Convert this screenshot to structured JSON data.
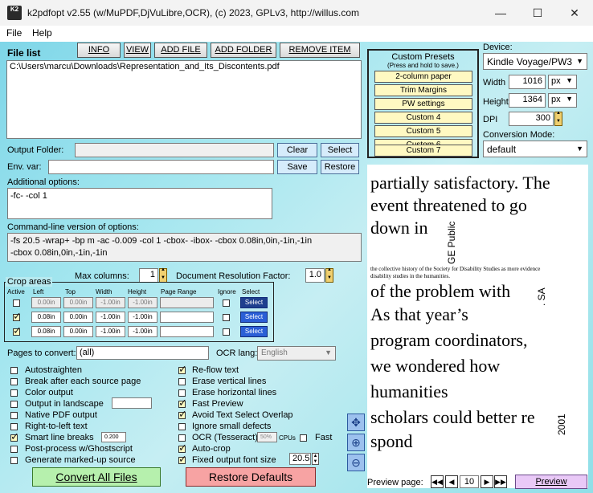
{
  "window": {
    "title": "k2pdfopt v2.55 (w/MuPDF,DjVuLibre,OCR), (c) 2023, GPLv3, http://willus.com",
    "logo": "K2"
  },
  "menu": {
    "file": "File",
    "help": "Help"
  },
  "toolbar": {
    "info": "INFO",
    "view": "VIEW",
    "add_file": "ADD FILE",
    "add_folder": "ADD FOLDER",
    "remove_item": "REMOVE ITEM"
  },
  "file_list": {
    "label": "File list",
    "items": [
      "C:\\Users\\marcu\\Downloads\\Representation_and_Its_Discontents.pdf"
    ]
  },
  "output_folder": {
    "label": "Output Folder:",
    "value": "",
    "clear": "Clear",
    "select": "Select"
  },
  "env_var": {
    "label": "Env. var:",
    "value": "",
    "save": "Save",
    "restore": "Restore"
  },
  "additional_options": {
    "label": "Additional options:",
    "value": "-fc- -col 1"
  },
  "command_line": {
    "label": "Command-line version of options:",
    "line1": "-fs 20.5 -wrap+ -bp m -ac -0.009 -col 1 -cbox- -ibox- -cbox 0.08in,0in,-1in,-1in",
    "line2": "-cbox 0.08in,0in,-1in,-1in"
  },
  "max_columns": {
    "label": "Max columns:",
    "value": "1"
  },
  "doc_res": {
    "label": "Document Resolution Factor:",
    "value": "1.0"
  },
  "crop": {
    "title": "Crop areas",
    "headers": {
      "active": "Active",
      "left": "Left",
      "top": "Top",
      "width": "Width",
      "height": "Height",
      "range": "Page Range",
      "ignore": "Ignore",
      "select": "Select"
    },
    "rows": [
      {
        "left": "0.00in",
        "top": "0.00in",
        "width": "-1.00in",
        "height": "-1.00in",
        "select": "Select"
      },
      {
        "left": "0.08in",
        "top": "0.00in",
        "width": "-1.00in",
        "height": "-1.00in",
        "select": "Select"
      },
      {
        "left": "0.08in",
        "top": "0.00in",
        "width": "-1.00in",
        "height": "-1.00in",
        "select": "Select"
      }
    ]
  },
  "pages": {
    "label": "Pages to convert:",
    "value": "(all)"
  },
  "ocr_lang": {
    "label": "OCR lang:",
    "value": "English"
  },
  "options_left": [
    "Autostraighten",
    "Break after each source page",
    "Color output",
    "Output in landscape",
    "Native PDF output",
    "Right-to-left text",
    "Smart line breaks",
    "Post-process w/Ghostscript",
    "Generate marked-up source"
  ],
  "smart_value": "0.200",
  "options_right": [
    "Re-flow text",
    "Erase vertical lines",
    "Erase horizontal lines",
    "Fast Preview",
    "Avoid Text Select Overlap",
    "Ignore small defects",
    "OCR (Tesseract)",
    "Auto-crop",
    "Fixed output font size"
  ],
  "ocr_cpu": {
    "value": "50%",
    "label": "CPUs",
    "fast": "Fast"
  },
  "font_size": "20.5",
  "convert": "Convert All Files",
  "restore_defaults": "Restore Defaults",
  "presets": {
    "title": "Custom Presets",
    "subtitle": "(Press and hold to save.)",
    "items": [
      "2-column paper",
      "Trim Margins",
      "PW settings",
      "Custom 4",
      "Custom 5",
      "Custom 6",
      "Custom 7"
    ]
  },
  "device": {
    "label": "Device:",
    "value": "Kindle Voyage/PW3"
  },
  "width": {
    "label": "Width",
    "value": "1016",
    "unit": "px"
  },
  "height": {
    "label": "Height",
    "value": "1364",
    "unit": "px"
  },
  "dpi": {
    "label": "DPI",
    "value": "300"
  },
  "conversion_mode": {
    "label": "Conversion Mode:",
    "value": "default"
  },
  "preview_text": {
    "lines": [
      "partially satisfactory. The",
      "event threatened to go",
      "down in"
    ],
    "side1": "GE Public",
    "note1": "the collective history of the Society for Disability Studies as more evidence",
    "note2": "disability studies in the humanities.",
    "lines2": [
      "of the problem with",
      "As that year’s",
      "program coordinators,",
      "we wondered how",
      "humanities",
      "scholars could better re",
      "spond"
    ],
    "side2": ". SA",
    "side3": "2001"
  },
  "preview_page": {
    "label": "Preview page:",
    "value": "10",
    "preview": "Preview"
  }
}
